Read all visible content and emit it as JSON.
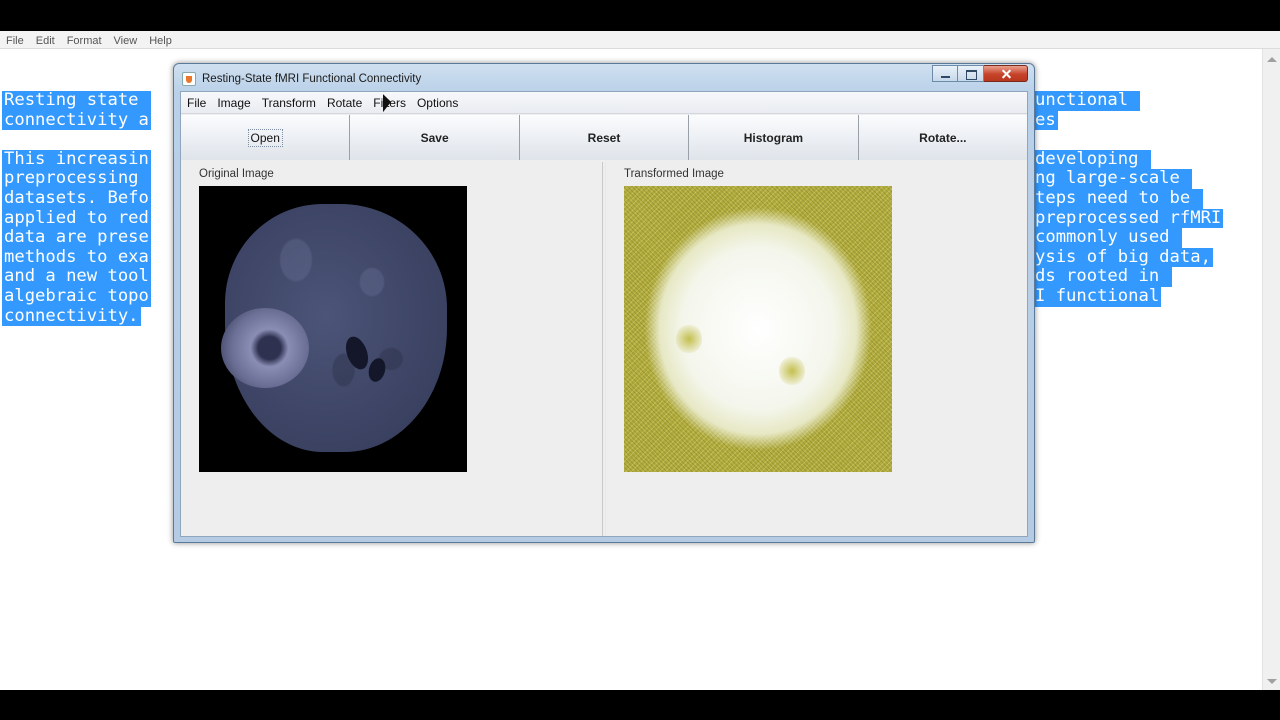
{
  "editor": {
    "menu": [
      "File",
      "Edit",
      "Format",
      "View",
      "Help"
    ],
    "left_lines": [
      "Resting state ",
      "connectivity a",
      "",
      "This increasin",
      "preprocessing ",
      "datasets. Befo",
      "applied to red",
      "data are prese",
      "methods to exa",
      "and a new tool",
      "algebraic topo",
      "connectivity."
    ],
    "right_lines": [
      "unctional ",
      "es",
      "",
      "developing ",
      "ng large-scale ",
      "teps need to be ",
      "preprocessed rfMRI",
      "commonly used ",
      "ysis of big data,",
      "ds rooted in ",
      "I functional"
    ]
  },
  "window": {
    "title": "Resting-State fMRI Functional Connectivity",
    "menu": [
      "File",
      "Image",
      "Transform",
      "Rotate",
      "Filters",
      "Options"
    ],
    "toolbar": [
      "Open",
      "Save",
      "Reset",
      "Histogram",
      "Rotate..."
    ],
    "panels": {
      "left_title": "Original Image",
      "right_title": "Transformed Image"
    }
  }
}
